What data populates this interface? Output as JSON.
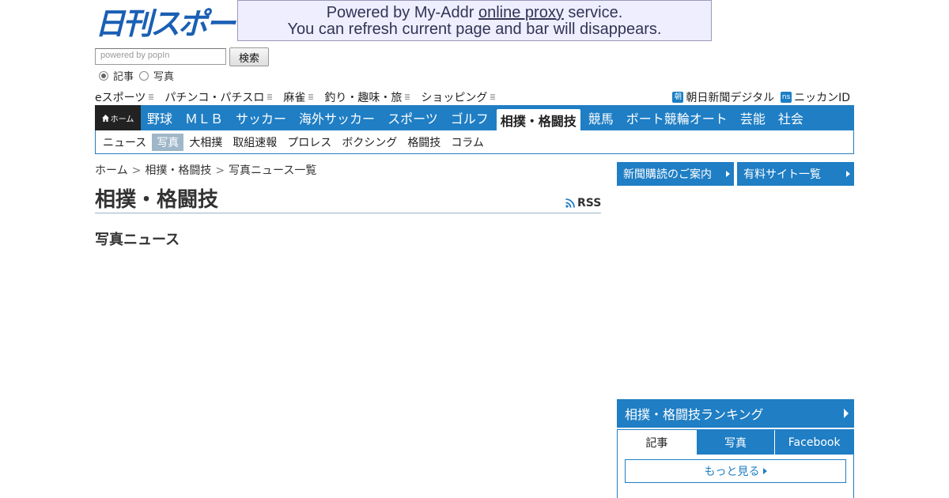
{
  "logo": {
    "text": "日刊スポーツ"
  },
  "proxy_bar": {
    "line1_prefix": "Powered by My-Addr ",
    "line1_link": "online proxy",
    "line1_suffix": " service.",
    "line2": "You can refresh current page and bar will disappears."
  },
  "search": {
    "placeholder": "powered by popIn",
    "button_label": "検索",
    "options": [
      {
        "label": "記事",
        "checked": true
      },
      {
        "label": "写真",
        "checked": false
      }
    ]
  },
  "subnav": {
    "items": [
      "eスポーツ",
      "パチンコ・パチスロ",
      "麻雀",
      "釣り・趣味・旅",
      "ショッピング"
    ]
  },
  "toplinks": [
    {
      "badge": "朝",
      "label": "朝日新聞デジタル"
    },
    {
      "badge": "ns",
      "label": "ニッカンID"
    }
  ],
  "mainnav": {
    "home_label": "ホーム",
    "items": [
      "野球",
      "ＭＬＢ",
      "サッカー",
      "海外サッカー",
      "スポーツ",
      "ゴルフ",
      "相撲・格闘技",
      "競馬",
      "ボート競輪オート",
      "芸能",
      "社会"
    ],
    "active_index": 6
  },
  "secnav": {
    "items": [
      "ニュース",
      "写真",
      "大相撲",
      "取組速報",
      "プロレス",
      "ボクシング",
      "格闘技",
      "コラム"
    ],
    "active_index": 1
  },
  "breadcrumb": [
    "ホーム",
    "相撲・格闘技",
    "写真ニュース一覧"
  ],
  "page_title": "相撲・格闘技",
  "rss_label": "RSS",
  "section_heading": "写真ニュース",
  "sidebar": {
    "buttons": [
      "新聞購読のご案内",
      "有料サイト一覧"
    ],
    "ranking": {
      "title": "相撲・格闘技ランキング",
      "tabs": [
        "記事",
        "写真",
        "Facebook"
      ],
      "active_tab": 0,
      "more_label": "もっと見る"
    }
  },
  "colors": {
    "nav_blue": "#1f7ec4",
    "home_dark": "#222222",
    "proxy_bg": "#eeeeff"
  }
}
